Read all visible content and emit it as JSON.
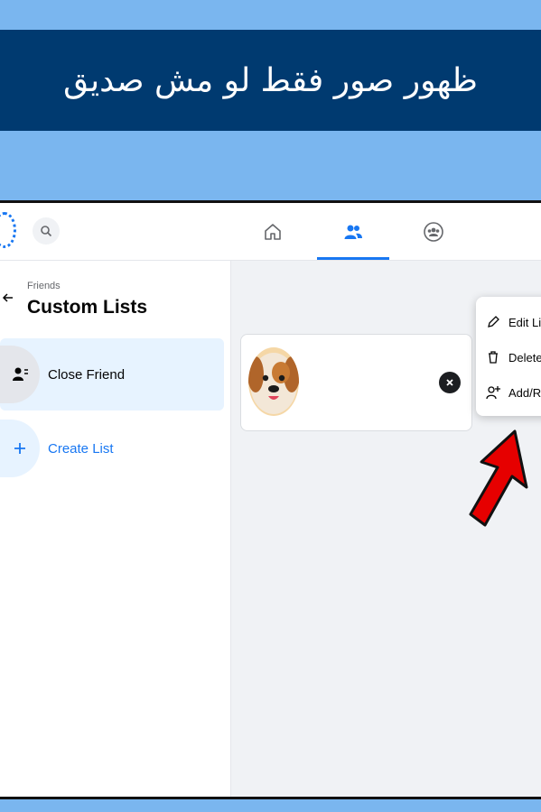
{
  "banner": {
    "title": "ظهور صور فقط لو مش صديق"
  },
  "topbar": {
    "icons": [
      "facebook-logo",
      "search-icon",
      "home-icon",
      "friends-icon",
      "groups-icon"
    ],
    "active_tab": "friends"
  },
  "sidebar": {
    "breadcrumb": "Friends",
    "title": "Custom Lists",
    "items": [
      {
        "label": "Close Friend",
        "icon": "person-list-icon",
        "selected": true
      },
      {
        "label": "Create List",
        "icon": "plus-icon",
        "selected": false
      }
    ]
  },
  "card": {
    "avatar": "dog-emoji-avatar",
    "remove_icon": "close-icon"
  },
  "menu": {
    "items": [
      {
        "label": "Edit Lis",
        "icon": "pencil-icon"
      },
      {
        "label": "Delete l",
        "icon": "trash-icon"
      },
      {
        "label": "Add/Re",
        "icon": "add-person-icon"
      }
    ]
  },
  "colors": {
    "accent": "#1877f2",
    "banner": "#003a70",
    "background": "#7ab6ef",
    "arrow": "#e60000"
  }
}
